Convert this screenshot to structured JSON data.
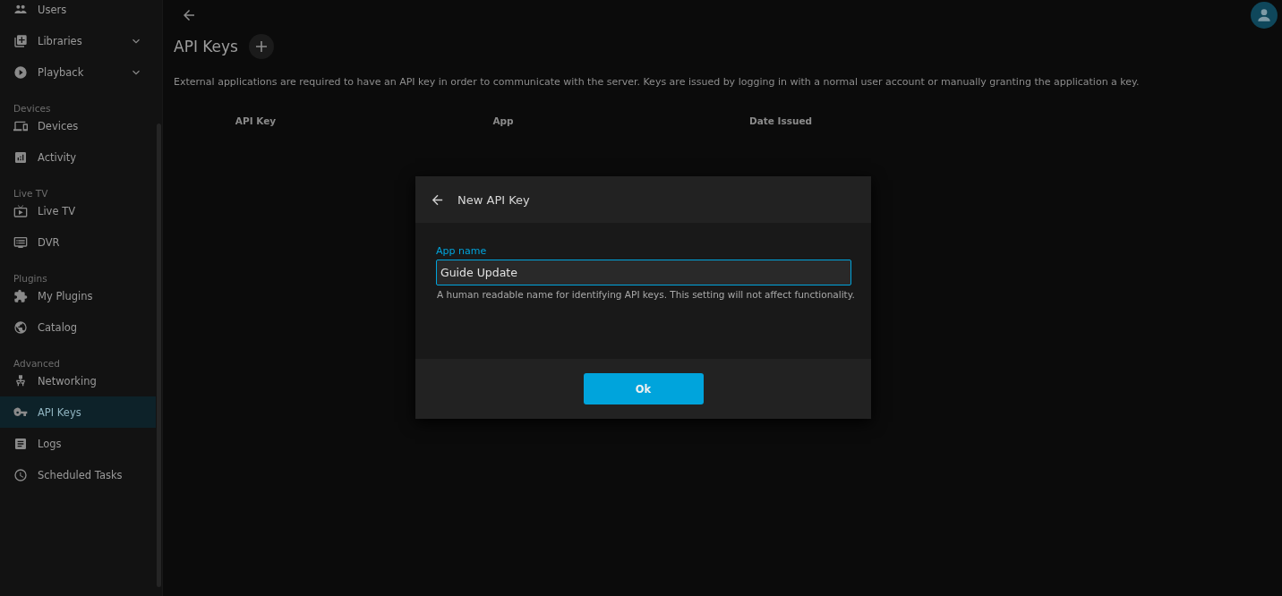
{
  "sidebar": {
    "groups": [
      {
        "items": [
          {
            "label": "Users",
            "selected": false
          },
          {
            "label": "Libraries",
            "selected": false,
            "expanded": false
          },
          {
            "label": "Playback",
            "selected": false,
            "expanded": false
          }
        ]
      },
      {
        "header": "Devices",
        "items": [
          {
            "label": "Devices",
            "selected": false
          },
          {
            "label": "Activity",
            "selected": false
          }
        ]
      },
      {
        "header": "Live TV",
        "items": [
          {
            "label": "Live TV",
            "selected": false
          },
          {
            "label": "DVR",
            "selected": false
          }
        ]
      },
      {
        "header": "Plugins",
        "items": [
          {
            "label": "My Plugins",
            "selected": false
          },
          {
            "label": "Catalog",
            "selected": false
          }
        ]
      },
      {
        "header": "Advanced",
        "items": [
          {
            "label": "Networking",
            "selected": false
          },
          {
            "label": "API Keys",
            "selected": true
          },
          {
            "label": "Logs",
            "selected": false
          },
          {
            "label": "Scheduled Tasks",
            "selected": false
          }
        ]
      }
    ]
  },
  "page": {
    "title": "API Keys",
    "description": "External applications are required to have an API key in order to communicate with the server. Keys are issued by logging in with a normal user account or manually granting the application a key.",
    "table": {
      "columns": [
        "API Key",
        "App",
        "Date Issued"
      ]
    }
  },
  "dialog": {
    "title": "New API Key",
    "field": {
      "label": "App name",
      "value": "Guide Update",
      "focused": true,
      "help": "A human readable name for identifying API keys. This setting will not affect functionality."
    },
    "button": "Ok"
  }
}
